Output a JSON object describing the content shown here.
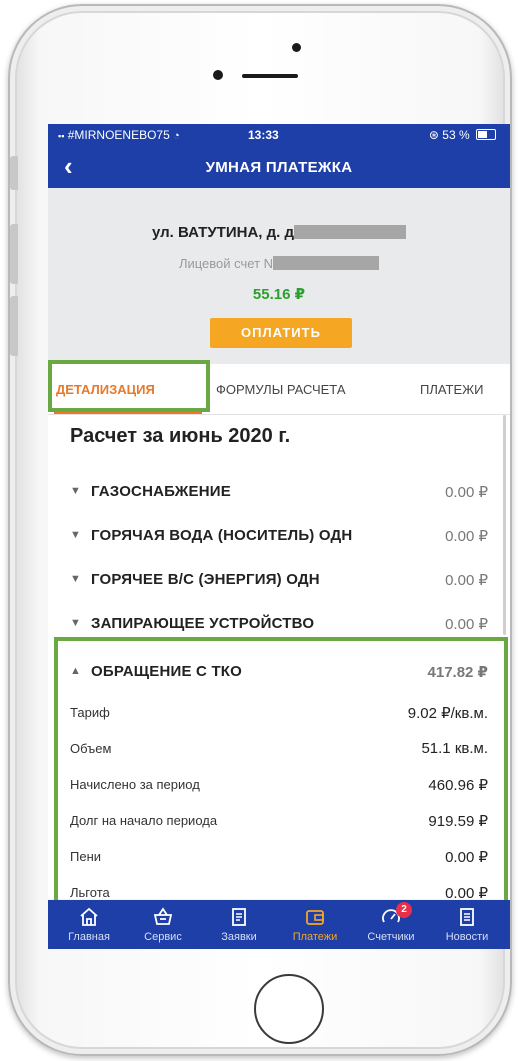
{
  "statusbar": {
    "carrier": "#MIRNOENEBO75",
    "time": "13:33",
    "battery": "53 %"
  },
  "navbar": {
    "back_label": "‹",
    "title": "УМНАЯ ПЛАТЕЖКА"
  },
  "account": {
    "address_prefix": "ул. ВАТУТИНА, д. д",
    "account_label": "Лицевой счет N",
    "balance": "55.16 ₽",
    "pay_button": "ОПЛАТИТЬ"
  },
  "tabs": [
    {
      "label": "ДЕТАЛИЗАЦИЯ",
      "active": true
    },
    {
      "label": "ФОРМУЛЫ РАСЧЕТА",
      "active": false
    },
    {
      "label": "ПЛАТЕЖИ",
      "active": false
    }
  ],
  "content": {
    "period_title": "Расчет за июнь 2020 г.",
    "services": [
      {
        "name": "ГАЗОСНАБЖЕНИЕ",
        "amount": "0.00 ₽",
        "expanded": false
      },
      {
        "name": "ГОРЯЧАЯ ВОДА (НОСИТЕЛЬ) ОДН",
        "amount": "0.00 ₽",
        "expanded": false
      },
      {
        "name": "ГОРЯЧЕЕ В/С (ЭНЕРГИЯ) ОДН",
        "amount": "0.00 ₽",
        "expanded": false
      },
      {
        "name": "ЗАПИРАЮЩЕЕ УСТРОЙСТВО",
        "amount": "0.00 ₽",
        "expanded": false
      },
      {
        "name": "ОБРАЩЕНИЕ С ТКО",
        "amount": "417.82 ₽",
        "expanded": true
      }
    ],
    "details": [
      {
        "label": "Тариф",
        "value": "9.02 ₽/кв.м."
      },
      {
        "label": "Объем",
        "value": "51.1 кв.м."
      },
      {
        "label": "Начислено за период",
        "value": "460.96 ₽"
      },
      {
        "label": "Долг на начало периода",
        "value": "919.59 ₽"
      },
      {
        "label": "Пени",
        "value": "0.00 ₽"
      },
      {
        "label": "Льгота",
        "value": "0.00 ₽"
      }
    ]
  },
  "tabbar": {
    "items": [
      {
        "label": "Главная",
        "icon": "home-icon"
      },
      {
        "label": "Сервис",
        "icon": "basket-icon"
      },
      {
        "label": "Заявки",
        "icon": "requests-icon"
      },
      {
        "label": "Платежи",
        "icon": "wallet-icon",
        "active": true
      },
      {
        "label": "Счетчики",
        "icon": "meter-icon",
        "badge": "2"
      },
      {
        "label": "Новости",
        "icon": "news-icon"
      }
    ]
  },
  "colors": {
    "brand_blue": "#1e3fa8",
    "accent_orange": "#f5a623",
    "highlight_green": "#6aa844",
    "balance_green": "#2ca02c"
  }
}
